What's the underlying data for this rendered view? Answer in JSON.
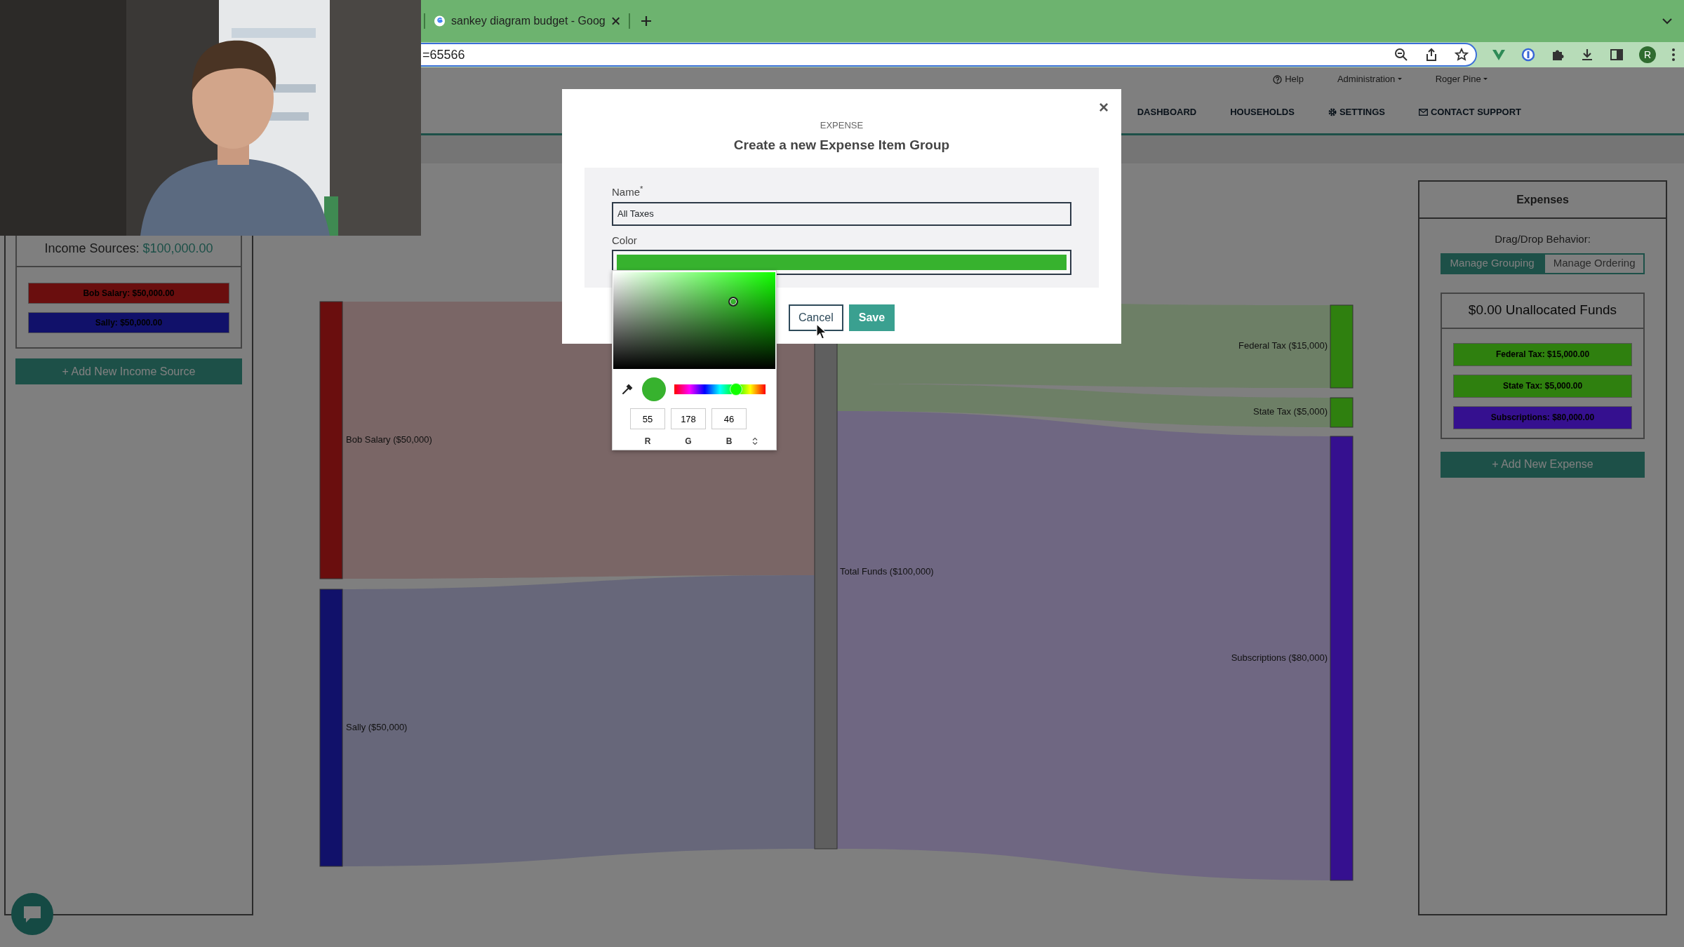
{
  "browser": {
    "tab_title": "sankey diagram budget - Goog",
    "address": "=65566",
    "avatar_letter": "R"
  },
  "hue_slider": {
    "level": 0.68
  },
  "top_nav": {
    "help": "Help",
    "menus": [
      "Administration",
      "Roger Pine"
    ]
  },
  "main_nav": [
    {
      "label": "DASHBOARD",
      "kind": "plain"
    },
    {
      "label": "HOUSEHOLDS",
      "kind": "plain"
    },
    {
      "label": "SETTINGS",
      "kind": "gear"
    },
    {
      "label": "CONTACT SUPPORT",
      "kind": "envelope"
    }
  ],
  "income": {
    "title": "Income Sources:",
    "total": "$100,000.00",
    "items": [
      {
        "label": "Bob Salary: $50,000.00",
        "color": "#6a0e0e"
      },
      {
        "label": "Sally: $50,000.00",
        "color": "#11116a"
      }
    ],
    "add_button": "+ Add New Income Source"
  },
  "sankey": {
    "sources": [
      {
        "label": "Bob Salary ($50,000)",
        "color": "#6a0e0e"
      },
      {
        "label": "Sally ($50,000)",
        "color": "#11116a"
      }
    ],
    "total": {
      "label": "Total Funds ($100,000)",
      "color": "#5f5f5f"
    },
    "targets": [
      {
        "label": "Federal Tax ($15,000)",
        "color": "#2f800f"
      },
      {
        "label": "State Tax ($5,000)",
        "color": "#2f800f"
      },
      {
        "label": "Subscriptions ($80,000)",
        "color": "#35108f"
      }
    ]
  },
  "expenses": {
    "title": "Expenses",
    "drag_label": "Drag/Drop Behavior:",
    "modes": [
      {
        "label": "Manage Grouping",
        "selected": true
      },
      {
        "label": "Manage Ordering",
        "selected": false
      }
    ],
    "unallocated": "$0.00 Unallocated Funds",
    "items": [
      {
        "label": "Federal Tax: $15,000.00",
        "color": "#2f800f"
      },
      {
        "label": "State Tax: $5,000.00",
        "color": "#2f800f"
      },
      {
        "label": "Subscriptions: $80,000.00",
        "color": "#35108f"
      }
    ],
    "add_button": "+ Add New Expense"
  },
  "modal": {
    "close": "×",
    "eyebrow": "EXPENSE",
    "title": "Create a new Expense Item Group",
    "name_label": "Name$^{*}$",
    "name_value": "All Taxes",
    "color_label": "Color",
    "buttons": [
      {
        "label": "Cancel",
        "kind": "secondary"
      },
      {
        "label": "Save",
        "kind": "primary"
      }
    ]
  },
  "color_picker": {
    "channels": [
      {
        "label": "R",
        "value": "55"
      },
      {
        "label": "G",
        "value": "178"
      },
      {
        "label": "B",
        "value": "46"
      }
    ]
  }
}
